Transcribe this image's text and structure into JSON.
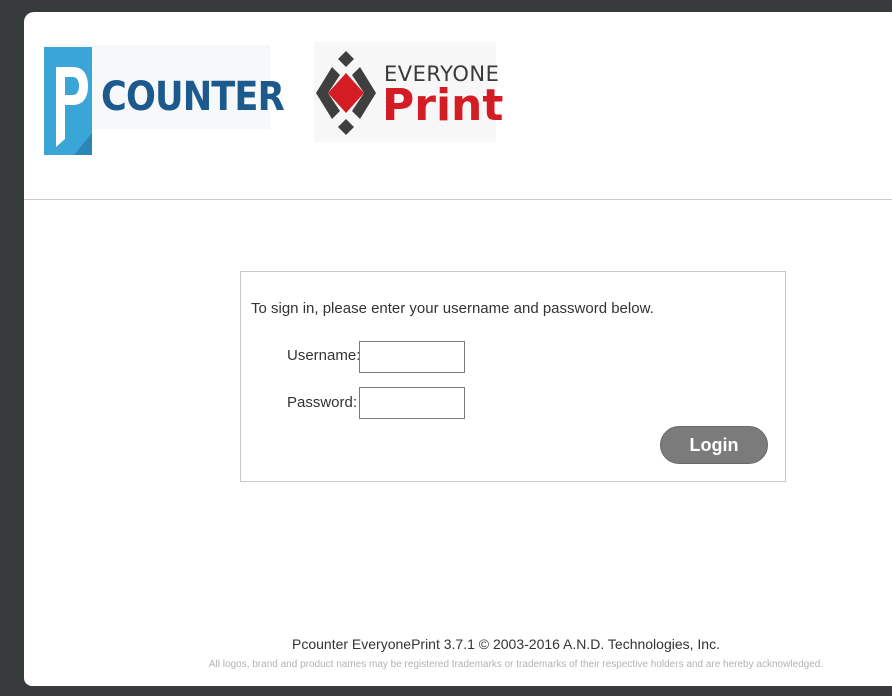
{
  "header": {
    "pcounter_logo": {
      "letter": "P",
      "wordmark": "COUNTER"
    },
    "everyoneprint_logo": {
      "top_text": "EVERYONE",
      "bottom_text": "Print"
    }
  },
  "login": {
    "instructions": "To sign in, please enter your username and password below.",
    "username_label": "Username:",
    "username_value": "",
    "password_label": "Password:",
    "password_value": "",
    "login_button": "Login"
  },
  "footer": {
    "copyright": "Pcounter EveryonePrint 3.7.1 © 2003-2016 A.N.D. Technologies, Inc.",
    "legal": "All logos, brand and product names may be registered trademarks or trademarks of their respective holders and are hereby acknowledged."
  },
  "colors": {
    "pcounter_blue": "#1c5a8e",
    "pcounter_tile": "#3aa6d8",
    "everyone_red": "#d41c24",
    "button_gray": "#7b7b7b"
  }
}
